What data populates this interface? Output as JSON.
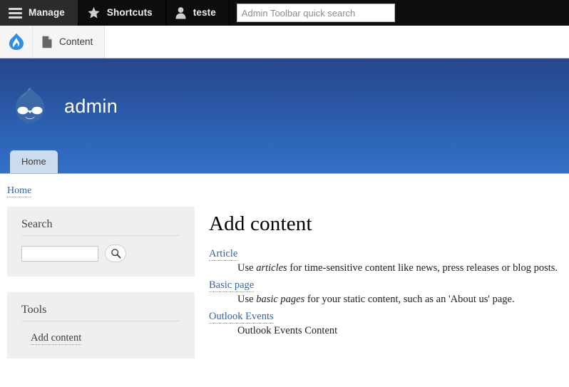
{
  "admin_toolbar": {
    "tabs": [
      {
        "label": "Manage",
        "icon": "hamburger-icon",
        "active": true
      },
      {
        "label": "Shortcuts",
        "icon": "star-icon",
        "active": false
      },
      {
        "label": "teste",
        "icon": "user-icon",
        "active": false
      }
    ],
    "search": {
      "value": "",
      "placeholder": "Admin Toolbar quick search"
    }
  },
  "toolbar_tray": {
    "home_icon": "drupal-drop-icon",
    "items": [
      {
        "label": "Content",
        "icon": "page-icon"
      }
    ]
  },
  "site_header": {
    "logo_icon": "druplicon-logo",
    "site_name": "admin",
    "tabs": [
      {
        "label": "Home",
        "active": true
      }
    ]
  },
  "breadcrumb": {
    "items": [
      {
        "label": "Home"
      }
    ]
  },
  "sidebar": {
    "blocks": [
      {
        "id": "search",
        "title": "Search",
        "input": {
          "value": "",
          "placeholder": ""
        },
        "submit_icon": "magnifier-icon"
      },
      {
        "id": "tools",
        "title": "Tools",
        "links": [
          {
            "label": "Add content"
          }
        ]
      }
    ]
  },
  "main": {
    "title": "Add content",
    "node_types": [
      {
        "link": "Article",
        "description_before": "Use ",
        "description_em": "articles",
        "description_after": " for time-sensitive content like news, press releases or blog posts."
      },
      {
        "link": "Basic page",
        "description_before": "Use ",
        "description_em": "basic pages",
        "description_after": " for your static content, such as an 'About us' page."
      },
      {
        "link": "Outlook Events",
        "description_before": "Outlook Events Content",
        "description_em": "",
        "description_after": ""
      }
    ]
  },
  "colors": {
    "toolbar_bg": "#0d0d0d",
    "header_top": "#27468c",
    "header_bottom": "#3370c6",
    "link": "#3366aa",
    "block_bg": "#f0efef",
    "drupal_blue": "#2f8de4"
  }
}
